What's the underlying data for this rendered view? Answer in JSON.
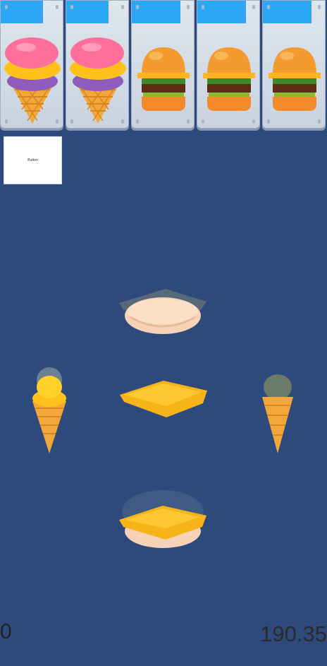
{
  "orders": [
    {
      "item": "ice-cream-cone",
      "timer_fraction": 0.68
    },
    {
      "item": "ice-cream-cone",
      "timer_fraction": 0.68
    },
    {
      "item": "burger",
      "timer_fraction": 0.78
    },
    {
      "item": "burger",
      "timer_fraction": 0.78
    },
    {
      "item": "burger",
      "timer_fraction": 0.78
    }
  ],
  "button": {
    "label": "Button"
  },
  "stations": [
    {
      "name": "bun-top-station"
    },
    {
      "name": "cheese-slice-station"
    },
    {
      "name": "assembled-burger-station"
    },
    {
      "name": "scoop-cone-station"
    },
    {
      "name": "empty-cone-station"
    }
  ],
  "hud": {
    "score": "0",
    "money": "190.35"
  },
  "colors": {
    "background": "#2e4a7d",
    "timer": "#2ba7f5",
    "card": "#dfe6ee"
  }
}
